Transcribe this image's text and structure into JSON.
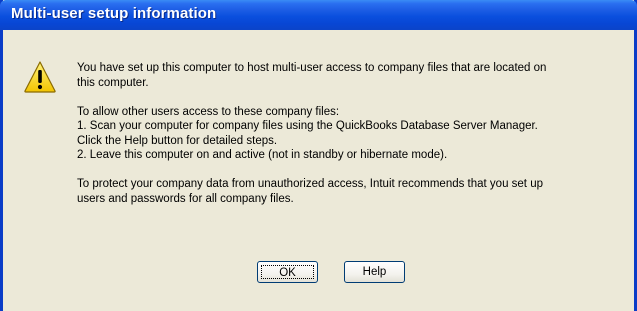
{
  "dialog": {
    "title": "Multi-user setup information",
    "icon": "warning-icon",
    "lines": [
      "You have set up this computer to host multi-user access to company files that are located on",
      "this computer.",
      "",
      "To allow other users access to these company files:",
      "1. Scan your computer for company files using the QuickBooks Database Server Manager.",
      "Click the Help button for detailed steps.",
      "2. Leave this computer on and active (not in standby or hibernate mode).",
      "",
      "To protect your company data from unauthorized access, Intuit recommends that you set up",
      "users and passwords for all company files."
    ],
    "buttons": {
      "ok_label": "OK",
      "help_label": "Help"
    }
  },
  "colors": {
    "titlebar": "#0a4fde",
    "dialog_bg": "#ece9d8",
    "warning_fill": "#f8d800"
  }
}
